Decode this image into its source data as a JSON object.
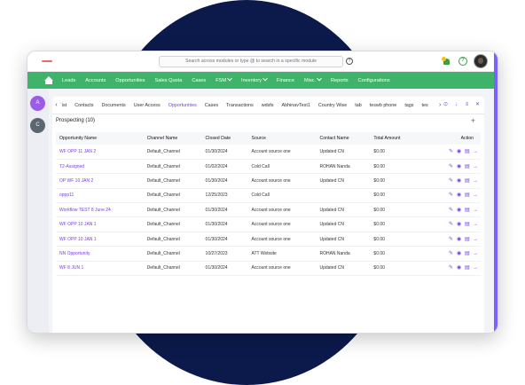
{
  "colors": {
    "accent": "#7b3fe4",
    "nav_green": "#3fb36a",
    "navy": "#0c1a4b"
  },
  "search": {
    "placeholder": "Search across modules or type @ to search in a specific module"
  },
  "header": {
    "help_glyph": "?",
    "help_glyph2": "?"
  },
  "nav": {
    "items": [
      {
        "label": "Leads"
      },
      {
        "label": "Accounts"
      },
      {
        "label": "Opportunities"
      },
      {
        "label": "Sales Quota"
      },
      {
        "label": "Cases"
      },
      {
        "label": "FSM",
        "dropdown": true
      },
      {
        "label": "Inventory",
        "dropdown": true
      },
      {
        "label": "Finance"
      },
      {
        "label": "Misc.",
        "dropdown": true
      },
      {
        "label": "Reports"
      },
      {
        "label": "Configurations"
      }
    ]
  },
  "rail": {
    "a": "A",
    "c": "C"
  },
  "tabs": {
    "left_arrow": "‹",
    "right_arrow": "›",
    "items": [
      "ʾist",
      "Contacts",
      "Documents",
      "User Access",
      "Opportunities",
      "Cases",
      "Transactions",
      "wdsfs",
      "AbhinavTest1",
      "Country Wise",
      "tab",
      "teswb phone",
      "tags",
      "tes"
    ],
    "active_index": 4
  },
  "panel": {
    "title": "Prospecting (10)",
    "add_icon": "+"
  },
  "table": {
    "headers": [
      "Opportunity Name",
      "Channel Name",
      "Closed Date",
      "Source",
      "Contact Name",
      "Total Amount",
      "Action"
    ],
    "rows": [
      [
        "WF OPP 11 JAN 2",
        "Default_Channel",
        "01/30/2024",
        "Account source one",
        "Updated CN",
        "$0.00"
      ],
      [
        "T2-Assigned",
        "Default_Channel",
        "01/02/2024",
        "Cold Call",
        "ROHAN Nanda",
        "$0.00"
      ],
      [
        "OP WF 10 JAN 2",
        "Default_Channel",
        "01/30/2024",
        "Account source one",
        "Updated CN",
        "$0.00"
      ],
      [
        "oppp11",
        "Default_Channel",
        "12/25/2023",
        "Cold Call",
        "",
        "$0.00"
      ],
      [
        "Workflow TEST 8 June 24",
        "Default_Channel",
        "01/30/2024",
        "Account source one",
        "Updated CN",
        "$0.00"
      ],
      [
        "WF OPP 10 JAN 1",
        "Default_Channel",
        "01/30/2024",
        "Account source one",
        "Updated CN",
        "$0.00"
      ],
      [
        "WF OPP 10 JAN 1",
        "Default_Channel",
        "01/30/2024",
        "Account source one",
        "Updated CN",
        "$0.00"
      ],
      [
        "NN Opportunity",
        "Default_Channel",
        "10/27/2023",
        "ATT Website",
        "ROHAN Nanda",
        "$0.00"
      ],
      [
        "WF 8 JUN 1",
        "Default_Channel",
        "01/30/2024",
        "Account source one",
        "Updated CN",
        "$0.00"
      ]
    ],
    "action_icons": [
      "edit-icon",
      "view-icon",
      "delete-icon",
      "arrow-right-icon"
    ]
  }
}
